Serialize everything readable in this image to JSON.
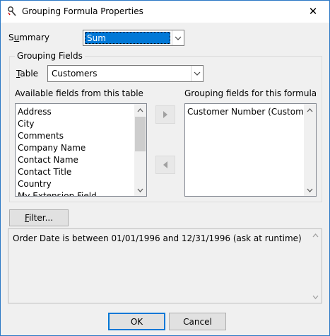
{
  "window": {
    "title": "Grouping Formula Properties",
    "close_glyph": "✕",
    "icon": "formula-wand-icon"
  },
  "summary": {
    "label_u": "u",
    "label_pre": "S",
    "label_post": "mmary",
    "value": "Sum"
  },
  "grouping": {
    "title": "Grouping Fields",
    "table_label_u": "T",
    "table_label_rest": "able",
    "table_value": "Customers",
    "available_label": "Available fields from this table",
    "selected_label": "Grouping fields for this formula",
    "available_fields": [
      "Address",
      "City",
      "Comments",
      "Company Name",
      "Contact Name",
      "Contact Title",
      "Country",
      "My Extension Field"
    ],
    "selected_fields": [
      "Customer Number (Customers)"
    ]
  },
  "filter": {
    "button_u": "F",
    "button_rest": "ilter...",
    "description": "Order Date is between 01/01/1996 and 12/31/1996 (ask at runtime)"
  },
  "buttons": {
    "ok": "OK",
    "cancel": "Cancel"
  },
  "colors": {
    "accent": "#0078d7",
    "window_bg": "#f0f0f0"
  }
}
